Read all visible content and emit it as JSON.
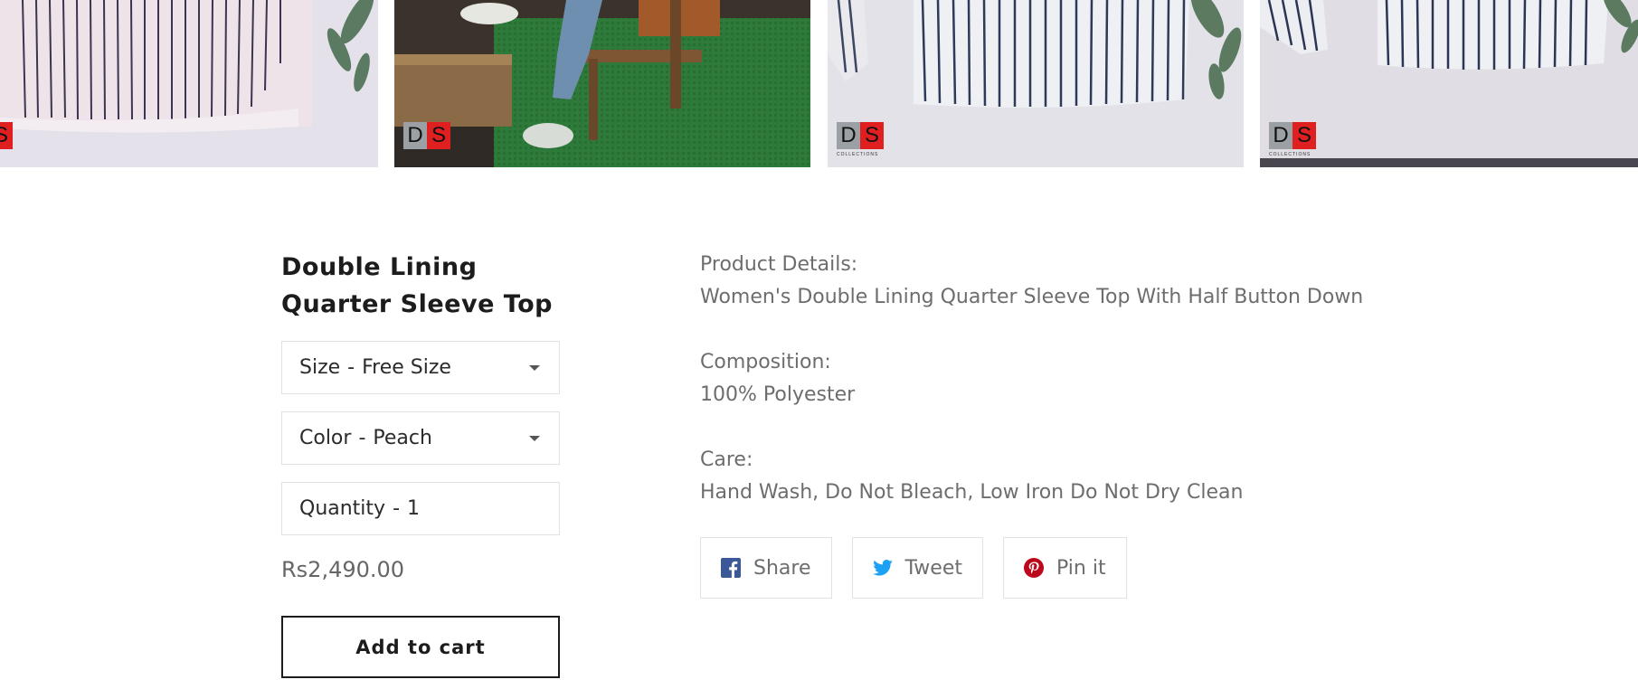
{
  "gallery": {
    "images": [
      {
        "alt": "striped-shirt-hem"
      },
      {
        "alt": "model-sitting-jeans"
      },
      {
        "alt": "striped-shirt-front"
      },
      {
        "alt": "striped-shirt-back"
      }
    ]
  },
  "product": {
    "title_line1": "Double Lining",
    "title_line2": "Quarter Sleeve Top",
    "size_label": "Size",
    "size_value": "Free Size",
    "color_label": "Color",
    "color_value": "Peach",
    "quantity_label": "Quantity",
    "quantity_value": "1",
    "separator": "-",
    "price": "Rs2,490.00",
    "add_to_cart": "Add to cart"
  },
  "details": {
    "details_heading": "Product Details:",
    "details_text": "Women's Double Lining Quarter Sleeve Top With Half Button Down",
    "composition_heading": "Composition:",
    "composition_text": "100% Polyester",
    "care_heading": "Care:",
    "care_text": "Hand Wash, Do Not Bleach, Low Iron Do Not Dry Clean"
  },
  "share": {
    "facebook": "Share",
    "twitter": "Tweet",
    "pinterest": "Pin it"
  },
  "logo": {
    "d": "D",
    "s": "S",
    "sub": "COLLECTIONS"
  },
  "colors": {
    "facebook": "#3b5998",
    "twitter": "#1da1f2",
    "pinterest": "#bd081c",
    "logo_red": "#e02020"
  }
}
